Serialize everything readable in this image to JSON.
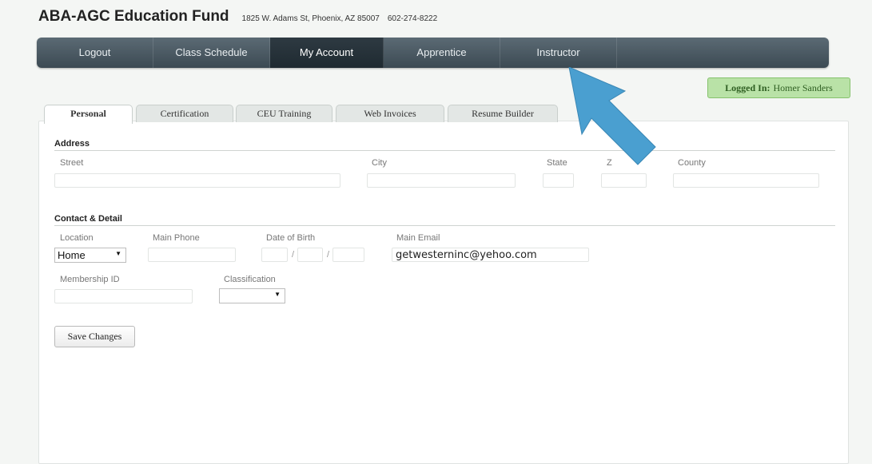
{
  "header": {
    "title": "ABA-AGC Education Fund",
    "address": "1825 W. Adams St, Phoenix, AZ 85007",
    "phone": "602-274-8222"
  },
  "nav": {
    "items": [
      {
        "label": "Logout"
      },
      {
        "label": "Class Schedule"
      },
      {
        "label": "My Account",
        "active": true
      },
      {
        "label": "Apprentice"
      },
      {
        "label": "Instructor"
      }
    ]
  },
  "logged_in": {
    "label": "Logged In:",
    "user": "Homer Sanders"
  },
  "tabs": [
    {
      "label": "Personal",
      "active": true
    },
    {
      "label": "Certification"
    },
    {
      "label": "CEU Training"
    },
    {
      "label": "Web Invoices"
    },
    {
      "label": "Resume Builder"
    }
  ],
  "address_section": {
    "title": "Address",
    "street_label": "Street",
    "city_label": "City",
    "state_label": "State",
    "zip_label": "Z",
    "county_label": "County"
  },
  "contact_section": {
    "title": "Contact & Detail",
    "location_label": "Location",
    "location_value": "Home",
    "main_phone_label": "Main Phone",
    "dob_label": "Date of Birth",
    "dob_separator": "/",
    "main_email_label": "Main Email",
    "main_email_value": "getwesterninc@yehoo.com",
    "membership_label": "Membership ID",
    "classification_label": "Classification",
    "classification_value": ""
  },
  "save_label": "Save Changes",
  "colors": {
    "nav_bg": "#4a5861",
    "logged_in_bg": "#b9e2a7",
    "arrow": "#4a9fd0"
  }
}
